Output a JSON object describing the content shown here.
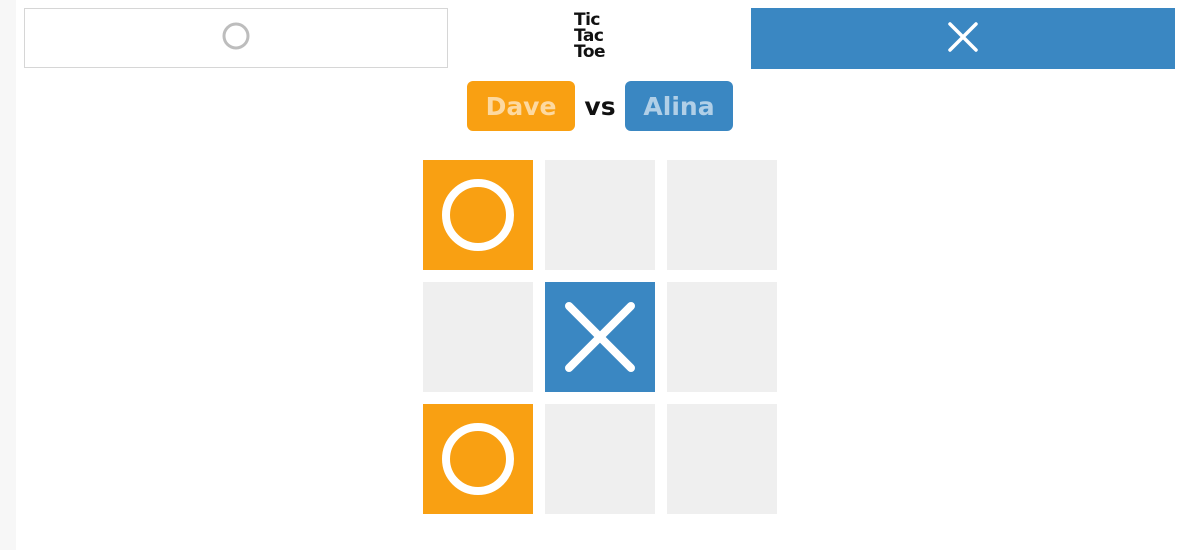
{
  "title_lines": [
    "Tic",
    "Tac",
    "Toe"
  ],
  "players": {
    "o": {
      "name": "Dave",
      "symbol": "O",
      "color": "#f9a012"
    },
    "x": {
      "name": "Alina",
      "symbol": "X",
      "color": "#3a87c2",
      "active": true
    }
  },
  "vs_label": "vs",
  "board": [
    [
      "O",
      "",
      ""
    ],
    [
      "",
      "X",
      ""
    ],
    [
      "O",
      "",
      ""
    ]
  ],
  "colors": {
    "empty_cell": "#efefef",
    "o_color": "#f9a012",
    "x_color": "#3a87c2",
    "panel_border": "#d6d6d6",
    "inactive_icon": "#bdbdbd"
  },
  "icons": {
    "o_panel": "circle-icon",
    "x_panel": "cross-icon"
  }
}
